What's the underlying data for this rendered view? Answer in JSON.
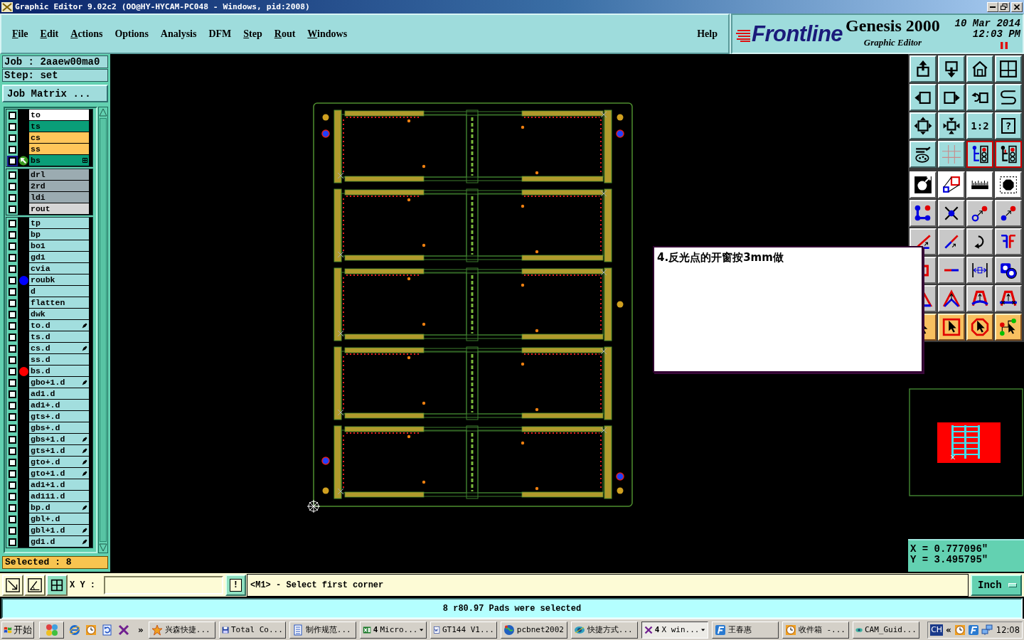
{
  "window": {
    "title": "Graphic Editor 9.02c2 (OO@HY-HYCAM-PC048 - Windows, pid:2008)"
  },
  "menu": {
    "items": [
      {
        "label": "File",
        "mnemonic": true
      },
      {
        "label": "Edit",
        "mnemonic": true
      },
      {
        "label": "Actions",
        "mnemonic": true
      },
      {
        "label": "Options",
        "mnemonic": false
      },
      {
        "label": "Analysis",
        "mnemonic": false
      },
      {
        "label": "DFM",
        "mnemonic": false
      },
      {
        "label": "Step",
        "mnemonic": true
      },
      {
        "label": "Rout",
        "mnemonic": true
      },
      {
        "label": "Windows",
        "mnemonic": true
      }
    ],
    "help": "Help"
  },
  "branding": {
    "logo": "Frontline",
    "product": "Genesis 2000",
    "subtitle": "Graphic Editor",
    "date": "10 Mar 2014",
    "time": "12:03 PM",
    "paused": true
  },
  "job_panel": {
    "job": "Job : 2aaew00ma0",
    "step": "Step: set",
    "matrix_button": "Job Matrix ...",
    "layer_groups": [
      {
        "layers": [
          {
            "name": "to",
            "color": "#ffffff",
            "checked": false,
            "work": false,
            "kind": "plain"
          },
          {
            "name": "ts",
            "color": "#0a9e78",
            "checked": false,
            "work": false,
            "kind": "plain"
          },
          {
            "name": "cs",
            "color": "#ffc65a",
            "checked": false,
            "work": false,
            "kind": "plain"
          },
          {
            "name": "ss",
            "color": "#ffc65a",
            "checked": false,
            "work": false,
            "kind": "plain"
          },
          {
            "name": "bs",
            "color": "#0a9e78",
            "checked": false,
            "work": true,
            "kind": "grid"
          }
        ]
      },
      {
        "layers": [
          {
            "name": "drl",
            "color": "#9babb1",
            "checked": false,
            "work": false,
            "kind": "plain"
          },
          {
            "name": "2rd",
            "color": "#9babb1",
            "checked": false,
            "work": false,
            "kind": "plain"
          },
          {
            "name": "ldi",
            "color": "#9babb1",
            "checked": false,
            "work": false,
            "kind": "plain"
          },
          {
            "name": "rout",
            "color": "#d6d6d6",
            "checked": false,
            "work": false,
            "kind": "plain"
          }
        ]
      },
      {
        "layers": [
          {
            "name": "tp",
            "color": "#a2dede",
            "checked": false,
            "work": false,
            "kind": "plain"
          },
          {
            "name": "bp",
            "color": "#a2dede",
            "checked": false,
            "work": false,
            "kind": "plain"
          },
          {
            "name": "bo1",
            "color": "#a2dede",
            "checked": false,
            "work": false,
            "kind": "plain"
          },
          {
            "name": "gd1",
            "color": "#a2dede",
            "checked": false,
            "work": false,
            "kind": "plain"
          },
          {
            "name": "cvia",
            "color": "#a2dede",
            "checked": false,
            "work": false,
            "kind": "plain"
          },
          {
            "name": "roubk",
            "color": "#a2dede",
            "checked": false,
            "work": false,
            "kind": "plain",
            "marker": {
              "color": "#0000ff"
            }
          },
          {
            "name": "d",
            "color": "#a2dede",
            "checked": false,
            "work": false,
            "kind": "plain"
          },
          {
            "name": "flatten",
            "color": "#a2dede",
            "checked": false,
            "work": false,
            "kind": "plain"
          },
          {
            "name": "dwk",
            "color": "#a2dede",
            "checked": false,
            "work": false,
            "kind": "plain"
          },
          {
            "name": "to.d",
            "color": "#a2dede",
            "checked": false,
            "work": false,
            "kind": "pen"
          },
          {
            "name": "ts.d",
            "color": "#a2dede",
            "checked": false,
            "work": false,
            "kind": "plain"
          },
          {
            "name": "cs.d",
            "color": "#a2dede",
            "checked": false,
            "work": false,
            "kind": "pen"
          },
          {
            "name": "ss.d",
            "color": "#a2dede",
            "checked": false,
            "work": false,
            "kind": "plain"
          },
          {
            "name": "bs.d",
            "color": "#a2dede",
            "checked": false,
            "work": false,
            "kind": "plain",
            "marker": {
              "color": "#ff0000"
            }
          },
          {
            "name": "gbo+1.d",
            "color": "#a2dede",
            "checked": false,
            "work": false,
            "kind": "pen"
          },
          {
            "name": "ad1.d",
            "color": "#a2dede",
            "checked": false,
            "work": false,
            "kind": "plain"
          },
          {
            "name": "ad1+.d",
            "color": "#a2dede",
            "checked": false,
            "work": false,
            "kind": "plain"
          },
          {
            "name": "gts+.d",
            "color": "#a2dede",
            "checked": false,
            "work": false,
            "kind": "plain"
          },
          {
            "name": "gbs+.d",
            "color": "#a2dede",
            "checked": false,
            "work": false,
            "kind": "plain"
          },
          {
            "name": "gbs+1.d",
            "color": "#a2dede",
            "checked": false,
            "work": false,
            "kind": "pen"
          },
          {
            "name": "gts+1.d",
            "color": "#a2dede",
            "checked": false,
            "work": false,
            "kind": "pen"
          },
          {
            "name": "gto+.d",
            "color": "#a2dede",
            "checked": false,
            "work": false,
            "kind": "pen"
          },
          {
            "name": "gto+1.d",
            "color": "#a2dede",
            "checked": false,
            "work": false,
            "kind": "pen"
          },
          {
            "name": "ad1+1.d",
            "color": "#a2dede",
            "checked": false,
            "work": false,
            "kind": "plain"
          },
          {
            "name": "ad111.d",
            "color": "#a2dede",
            "checked": false,
            "work": false,
            "kind": "plain"
          },
          {
            "name": "bp.d",
            "color": "#a2dede",
            "checked": false,
            "work": false,
            "kind": "pen"
          },
          {
            "name": "gbl+.d",
            "color": "#a2dede",
            "checked": false,
            "work": false,
            "kind": "plain"
          },
          {
            "name": "gbl+1.d",
            "color": "#a2dede",
            "checked": false,
            "work": false,
            "kind": "pen"
          },
          {
            "name": "gd1.d",
            "color": "#a2dede",
            "checked": false,
            "work": false,
            "kind": "pen"
          }
        ]
      }
    ],
    "selected": "Selected : 8"
  },
  "canvas": {
    "note": "4.反光点的开窗按3mm做"
  },
  "toolbar": {
    "groups": [
      {
        "kind": "view",
        "buttons": [
          {
            "on": false
          },
          {
            "on": false
          },
          {
            "on": false
          },
          {
            "on": false
          },
          {
            "on": false
          },
          {
            "on": false
          },
          {
            "on": false
          },
          {
            "on": false
          },
          {
            "on": false
          },
          {
            "on": false
          },
          {
            "label": "1:2",
            "on": false
          },
          {
            "label": "?",
            "on": false
          },
          {
            "on": false
          },
          {
            "on": false
          },
          {
            "on": true
          },
          {
            "on": true
          }
        ]
      },
      {
        "kind": "measure",
        "buttons": [
          {
            "on": false
          },
          {
            "on": false
          },
          {
            "on": false
          },
          {
            "on": false
          }
        ]
      },
      {
        "kind": "edit",
        "buttons": [
          {
            "on": false
          },
          {
            "on": false
          },
          {
            "on": false
          },
          {
            "on": false
          },
          {
            "on": false
          },
          {
            "on": false
          },
          {
            "on": false
          },
          {
            "on": false
          },
          {
            "on": false
          },
          {
            "on": false
          },
          {
            "on": false
          },
          {
            "on": false
          },
          {
            "on": false
          },
          {
            "on": false
          },
          {
            "on": false
          },
          {
            "on": false
          }
        ]
      },
      {
        "kind": "select",
        "buttons": [
          {
            "on": false
          },
          {
            "on": false
          },
          {
            "on": false
          },
          {
            "on": false
          }
        ]
      }
    ]
  },
  "coordinates": {
    "x": "X = 0.777096\"",
    "y": "Y = 3.495795\""
  },
  "command_line": {
    "label": "X Y :",
    "alert": "!",
    "prompt": "<M1> - Select first corner",
    "units": "Inch"
  },
  "status_bar": {
    "message": "8 r80.97 Pads were selected"
  },
  "taskbar": {
    "start": "开始",
    "more": "»",
    "tasks": [
      {
        "label": "兴森快捷...",
        "selected": false
      },
      {
        "label": "Total Co...",
        "selected": false
      },
      {
        "label": "制作规范...",
        "selected": false
      },
      {
        "count": "4",
        "label": "Micro...",
        "selected": false
      },
      {
        "label": "GT144 V1...",
        "selected": false
      },
      {
        "label": "pcbnet2002",
        "selected": false
      },
      {
        "label": "快捷方式...",
        "selected": false
      },
      {
        "count": "4",
        "label": "X win...",
        "selected": true
      },
      {
        "label": "王春惠",
        "selected": false
      },
      {
        "label": "收件箱 -...",
        "selected": false
      },
      {
        "label": "CAM_Guid...",
        "selected": false
      }
    ],
    "tray": {
      "language": "CH",
      "expand": "«",
      "clock": "12:08"
    }
  }
}
